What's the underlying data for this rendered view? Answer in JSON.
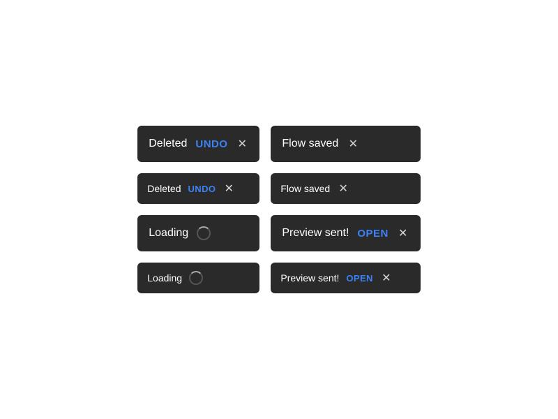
{
  "toasts": {
    "row1": [
      {
        "id": "deleted-1",
        "text": "Deleted",
        "action": "UNDO",
        "hasClose": true,
        "hasSpinner": false,
        "size": "large"
      },
      {
        "id": "flow-saved-1",
        "text": "Flow saved",
        "action": null,
        "hasClose": true,
        "hasSpinner": false,
        "size": "large"
      }
    ],
    "row2": [
      {
        "id": "deleted-2",
        "text": "Deleted",
        "action": "UNDO",
        "hasClose": true,
        "hasSpinner": false,
        "size": "small"
      },
      {
        "id": "flow-saved-2",
        "text": "Flow saved",
        "action": null,
        "hasClose": true,
        "hasSpinner": false,
        "size": "small"
      }
    ],
    "row3": [
      {
        "id": "loading-1",
        "text": "Loading",
        "action": null,
        "hasClose": false,
        "hasSpinner": true,
        "size": "large"
      },
      {
        "id": "preview-sent-1",
        "text": "Preview sent!",
        "action": "OPEN",
        "hasClose": true,
        "hasSpinner": false,
        "size": "large"
      }
    ],
    "row4": [
      {
        "id": "loading-2",
        "text": "Loading",
        "action": null,
        "hasClose": false,
        "hasSpinner": true,
        "size": "small"
      },
      {
        "id": "preview-sent-2",
        "text": "Preview sent!",
        "action": "OPEN",
        "hasClose": true,
        "hasSpinner": false,
        "size": "small"
      }
    ]
  },
  "colors": {
    "action": "#3b82f6",
    "background": "#2a2a2a",
    "text": "#ffffff"
  }
}
